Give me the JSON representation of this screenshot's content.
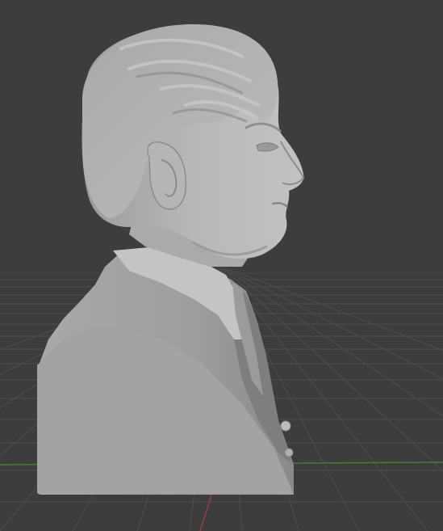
{
  "viewport": {
    "kind": "3D viewport",
    "background_color": "#3d3d3d",
    "grid_color": "#505050",
    "x_axis_color": "#9a3a3a",
    "y_axis_color": "#3d7a2e"
  },
  "scene": {
    "object": "sculpted bust",
    "material_color": "#b3b3b3",
    "shadow_color": "#6e6e6e",
    "highlight_color": "#d3d3d3"
  }
}
